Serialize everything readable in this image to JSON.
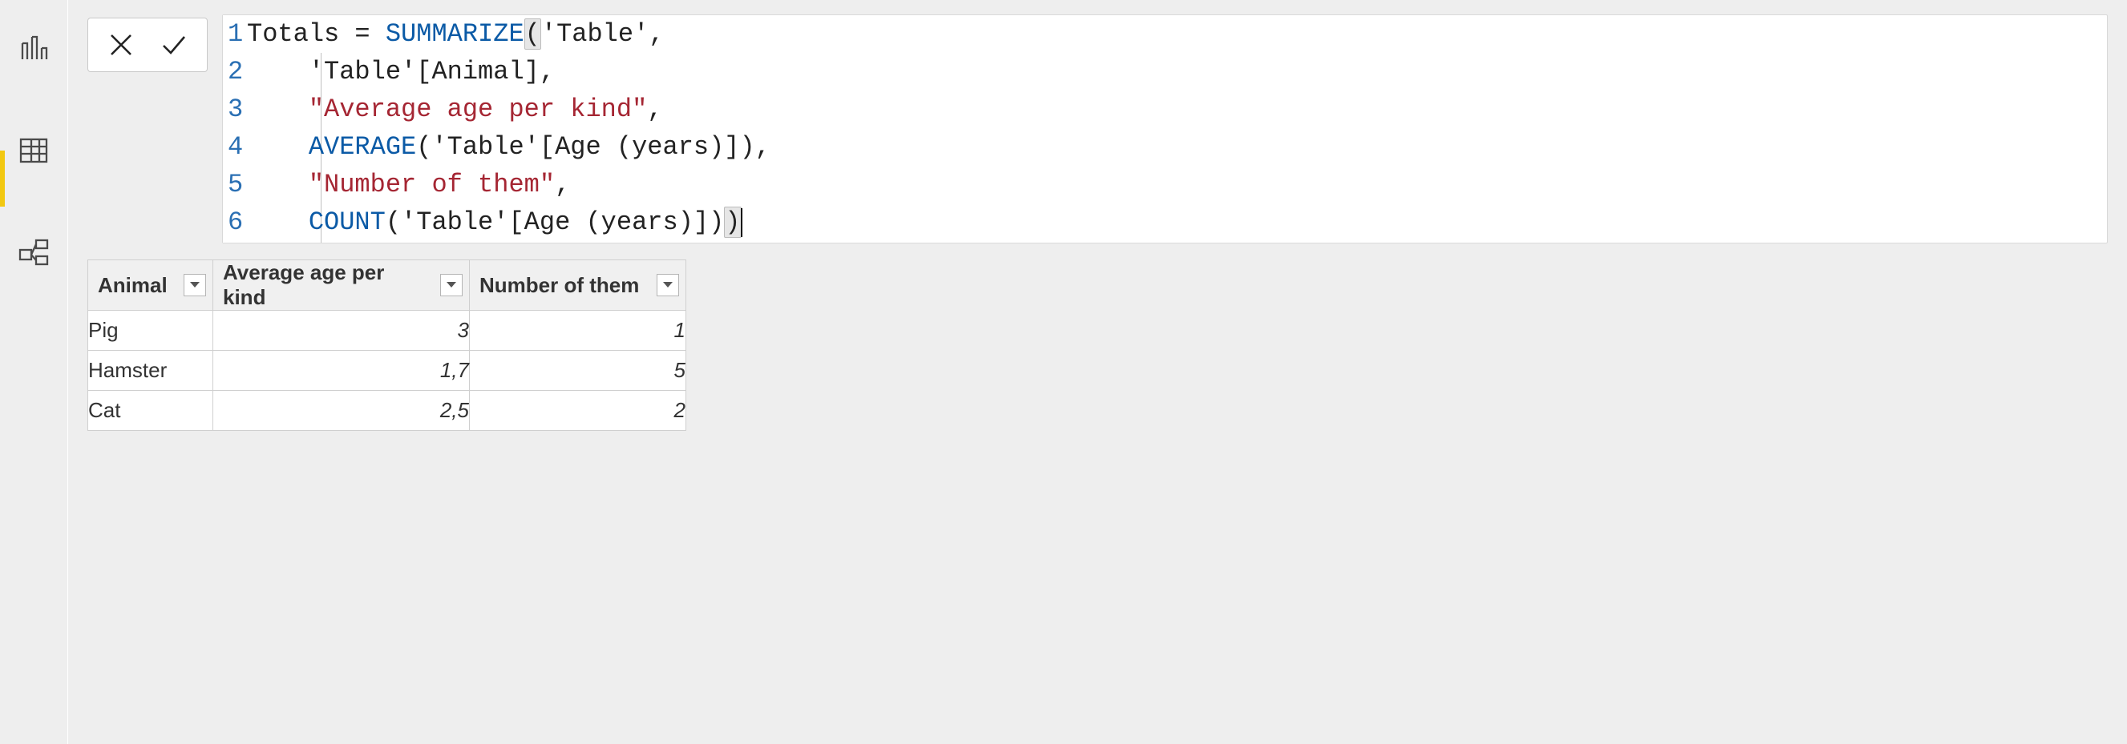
{
  "nav": {
    "items": [
      "report-view",
      "data-view",
      "model-view"
    ],
    "active_index": 1
  },
  "formula_bar": {
    "cancel_tooltip": "Cancel",
    "commit_tooltip": "Commit"
  },
  "formula": {
    "line_numbers": [
      "1",
      "2",
      "3",
      "4",
      "5",
      "6"
    ],
    "lines": [
      {
        "tokens": [
          {
            "t": "Totals = ",
            "k": "plain"
          },
          {
            "t": "SUMMARIZE",
            "k": "func"
          },
          {
            "t": "(",
            "k": "bracket_hl"
          },
          {
            "t": "'Table',",
            "k": "plain"
          }
        ]
      },
      {
        "indent": "    ",
        "tokens": [
          {
            "t": "'Table'[Animal],",
            "k": "plain"
          }
        ]
      },
      {
        "indent": "    ",
        "tokens": [
          {
            "t": "\"Average age per kind\"",
            "k": "str"
          },
          {
            "t": ",",
            "k": "plain"
          }
        ]
      },
      {
        "indent": "    ",
        "tokens": [
          {
            "t": "AVERAGE",
            "k": "func"
          },
          {
            "t": "('Table'[Age (years)]),",
            "k": "plain"
          }
        ]
      },
      {
        "indent": "    ",
        "tokens": [
          {
            "t": "\"Number of them\"",
            "k": "str"
          },
          {
            "t": ",",
            "k": "plain"
          }
        ]
      },
      {
        "indent": "    ",
        "tokens": [
          {
            "t": "COUNT",
            "k": "func"
          },
          {
            "t": "('Table'[Age (years)])",
            "k": "plain"
          },
          {
            "t": ")",
            "k": "bracket_hl"
          },
          {
            "t": "",
            "k": "caret"
          }
        ]
      }
    ]
  },
  "table": {
    "columns": [
      {
        "key": "animal",
        "label": "Animal",
        "class": "col-animal",
        "align": "text"
      },
      {
        "key": "avg",
        "label": "Average age per kind",
        "class": "col-avg",
        "align": "num"
      },
      {
        "key": "count",
        "label": "Number of them",
        "class": "col-count",
        "align": "num"
      }
    ],
    "rows": [
      {
        "animal": "Pig",
        "avg": "3",
        "count": "1"
      },
      {
        "animal": "Hamster",
        "avg": "1,7",
        "count": "5"
      },
      {
        "animal": "Cat",
        "avg": "2,5",
        "count": "2"
      }
    ]
  }
}
